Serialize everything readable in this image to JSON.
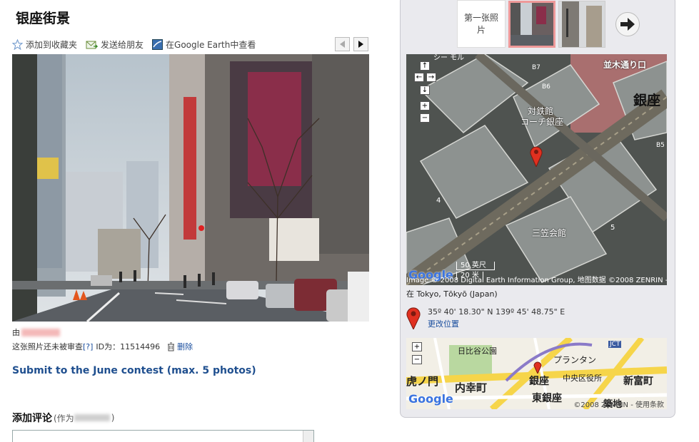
{
  "page": {
    "title": "银座街景"
  },
  "actions": [
    {
      "label": "添加到收藏夹",
      "icon": "star-icon"
    },
    {
      "label": "发送给朋友",
      "icon": "send-mail-icon"
    },
    {
      "label": "在Google Earth中查看",
      "icon": "google-earth-icon"
    }
  ],
  "photo_info": {
    "by_prefix": "由",
    "review_text": "这张照片还未被审查",
    "help_link": "[?]",
    "id_label": "ID为：",
    "id_value": "11514496",
    "delete_label": "删除"
  },
  "contest": {
    "link_text": "Submit to the June contest (max. 5 photos)"
  },
  "comment": {
    "heading": "添加评论",
    "as_prefix": "(作为",
    "as_suffix": ")"
  },
  "thumbnails": {
    "first_label": "第一张照片"
  },
  "satellite_map": {
    "labels": {
      "b7": "B7",
      "b6": "B6",
      "b5": "B5",
      "num4": "4",
      "num5": "5",
      "namiki": "並木通り口",
      "ginza": "銀座",
      "taisekikan": "対鉄館",
      "coach": "コーチ銀座",
      "misakan": "三笠会館",
      "scale": "50 英尺",
      "scale2": "20 米",
      "copyright": "Image © 2008 Digital Earth Information Group, 地图数据 ©2008 ZENRIN - 使用条款",
      "google": "Google",
      "top_label": "シー モル"
    },
    "controls": [
      "↑",
      "←",
      "→",
      "↓",
      "+",
      "−"
    ]
  },
  "location": {
    "prefix": "在",
    "place": "Tokyo, Tōkyō (Japan)",
    "coords": "35º 40' 18.30\" N 139º 45' 48.75\" E",
    "change_link": "更改位置"
  },
  "street_map": {
    "labels": {
      "hibiya": "日比谷公園",
      "toranomon": "虎ノ門",
      "uchisaiwaicho": "内幸町",
      "ginza": "銀座",
      "printemps": "プランタン",
      "chuo": "中央区役所",
      "shintomicho": "新富町",
      "higashiginza": "東銀座",
      "tsukiji": "築地",
      "copyright": "©2008 ZENRIN - 使用条款",
      "google": "Google",
      "jct": "JCT"
    },
    "controls": [
      "+",
      "−"
    ]
  },
  "colors": {
    "link": "#1a4e9e",
    "contest": "#1f4f8f",
    "panel_bg": "#eaeaee",
    "selected_thumb_border": "#ee9999",
    "pin": "#e03020"
  }
}
